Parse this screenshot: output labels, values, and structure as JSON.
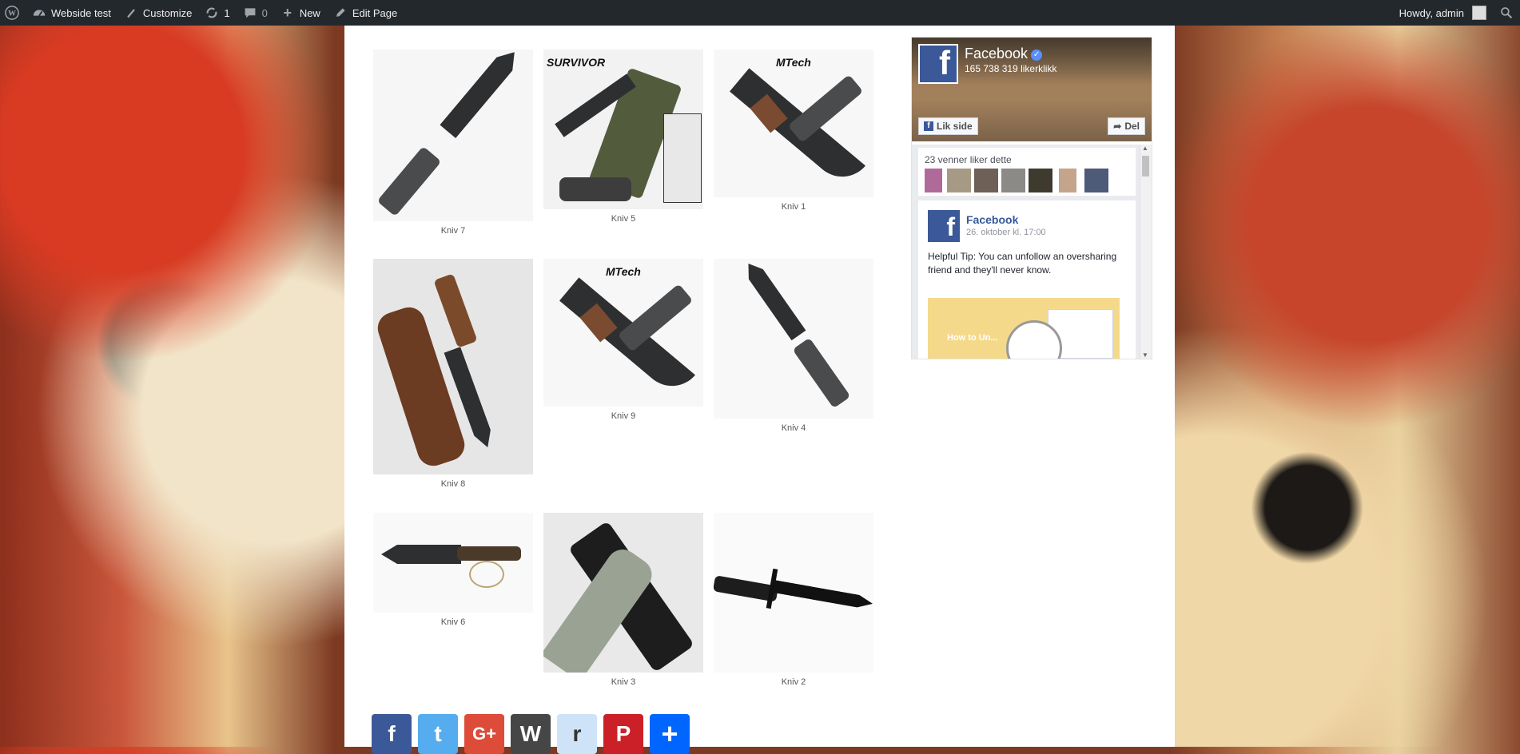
{
  "adminbar": {
    "site_name": "Webside test",
    "customize": "Customize",
    "updates_count": "1",
    "comments_count": "0",
    "new_label": "New",
    "edit_page": "Edit Page",
    "howdy": "Howdy, admin"
  },
  "gallery": {
    "items": [
      {
        "caption": "Kniv 7"
      },
      {
        "caption": "Kniv 5",
        "brand": "SURVIVOR"
      },
      {
        "caption": "Kniv 1",
        "brand": "MTech"
      },
      {
        "caption": "Kniv 8"
      },
      {
        "caption": "Kniv 9",
        "brand": "MTech"
      },
      {
        "caption": "Kniv 4"
      },
      {
        "caption": "Kniv 6"
      },
      {
        "caption": "Kniv 3"
      },
      {
        "caption": "Kniv 2"
      }
    ]
  },
  "facebook": {
    "page_name": "Facebook",
    "likes": "165 738 319 likerklikk",
    "like_button": "Lik side",
    "share_button": "Del",
    "friends_like": "23 venner liker dette",
    "post": {
      "author": "Facebook",
      "date": "26. oktober kl. 17:00",
      "text": "Helpful Tip: You can unfollow an oversharing friend and they'll never know.",
      "media_title": "How to Un..."
    }
  },
  "share_buttons": [
    {
      "name": "facebook",
      "glyph": "f",
      "color": "#3b5998"
    },
    {
      "name": "twitter",
      "glyph": "t",
      "color": "#55acee"
    },
    {
      "name": "google-plus",
      "glyph": "G+",
      "color": "#dd4b39"
    },
    {
      "name": "wordpress",
      "glyph": "W",
      "color": "#464646"
    },
    {
      "name": "reddit",
      "glyph": "r",
      "color": "#cee3f8"
    },
    {
      "name": "pinterest",
      "glyph": "P",
      "color": "#cb2027"
    },
    {
      "name": "more",
      "glyph": "+",
      "color": "#0166ff"
    }
  ]
}
